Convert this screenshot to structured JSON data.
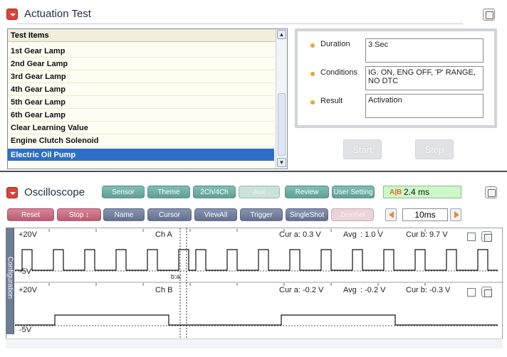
{
  "actuation": {
    "title": "Actuation Test",
    "list_header": "Test Items",
    "items": [
      "1st Gear Lamp",
      "2nd Gear Lamp",
      "3rd Gear Lamp",
      "4th Gear Lamp",
      "5th Gear Lamp",
      "6th Gear Lamp",
      "Clear Learning Value",
      "Engine Clutch Solenoid",
      "Electric Oil Pump"
    ],
    "selected_index": 8,
    "info": {
      "duration_label": "Duration",
      "duration_value": "3 Sec",
      "conditions_label": "Conditions",
      "conditions_value": "IG. ON, ENG OFF, 'P' RANGE, NO DTC",
      "result_label": "Result",
      "result_value": "Activation"
    },
    "start_label": "Start",
    "stop_label": "Stop"
  },
  "oscilloscope": {
    "title": "Oscilloscope",
    "tabs": [
      "Sensor",
      "Theme",
      "2Ch/4Ch",
      "Aux",
      "Review",
      "User Setting"
    ],
    "time_readout": "2.4 ms",
    "buttons": [
      "Reset",
      "Stop ↕",
      "Name",
      "Cursor",
      "ViewAll",
      "Trigger",
      "SingleShot",
      "ZeroSet"
    ],
    "timebase": "10ms",
    "side_tab": "Configuration",
    "channels": [
      {
        "max": "+20V",
        "min": "-5V",
        "name": "Ch A",
        "cur_a": "Cur a: 0.3 V",
        "avg_label": "Avg",
        "avg": ": 1.0 V",
        "cur_b": "Cur b: 9.7 V"
      },
      {
        "max": "+20V",
        "min": "-5V",
        "name": "Ch B",
        "cur_a": "Cur a: -0.2 V",
        "avg_label": "Avg",
        "avg": ": -0.2 V",
        "cur_b": "Cur b: -0.3 V"
      }
    ],
    "cursor_label": "b:a:"
  },
  "colors": {
    "accent_red": "#d9443b",
    "selection": "#2d6ec9",
    "teal": "#6fae a4",
    "pink": "#c56c80",
    "timestamp_bg": "#cdf7c8"
  }
}
